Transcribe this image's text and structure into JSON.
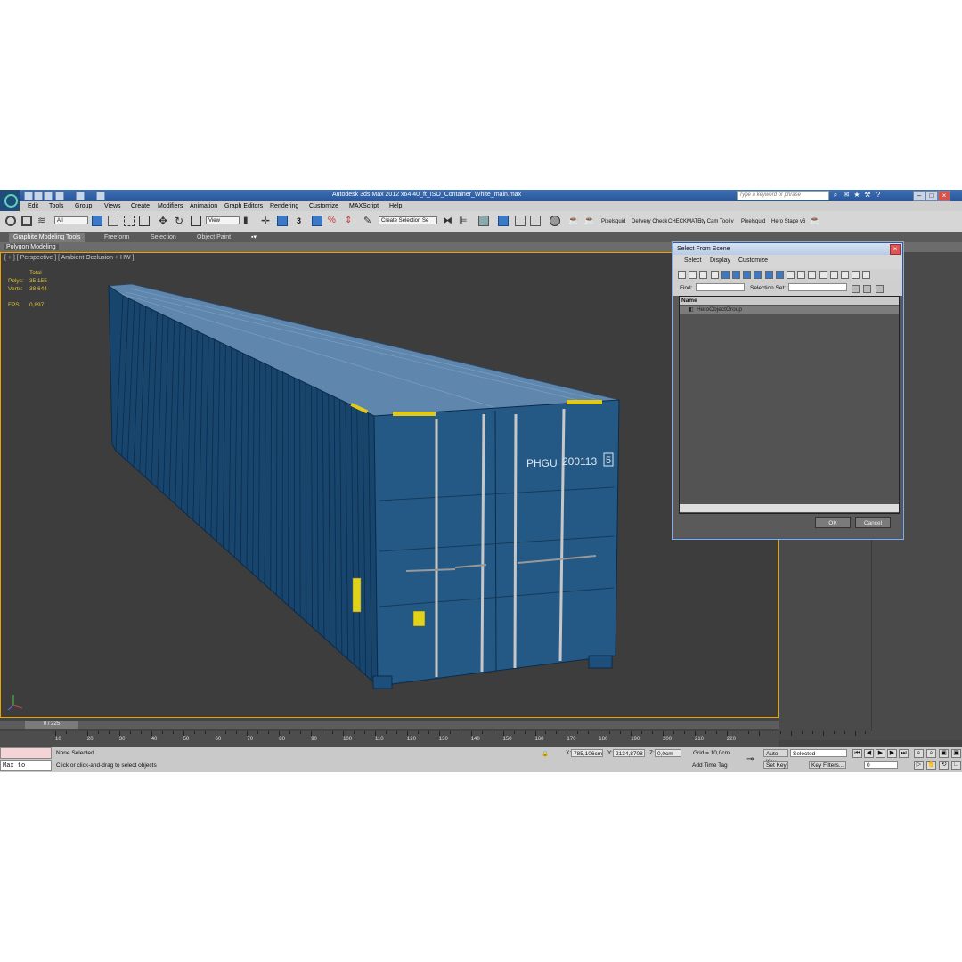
{
  "window": {
    "title": "Autodesk 3ds Max  2012 x64     40_ft_ISO_Container_White_main.max",
    "search_placeholder": "Type a keyword or phrase"
  },
  "menu": [
    "Edit",
    "Tools",
    "Group",
    "Views",
    "Create",
    "Modifiers",
    "Animation",
    "Graph Editors",
    "Rendering",
    "Customize",
    "MAXScript",
    "Help"
  ],
  "toolbar": {
    "selection_filter": "All",
    "reference_coord": "View",
    "named_selection": "Create Selection Se",
    "snap_value": "3",
    "plugins": [
      "Pixelsquid",
      "Delivery Check",
      "CHECKMATE",
      "ity Cam Tool v",
      "Pixelsquid",
      "Hero Stage v6"
    ]
  },
  "ribbon": {
    "tabs": [
      "Graphite Modeling Tools",
      "Freeform",
      "Selection",
      "Object Paint"
    ],
    "panel": "Polygon Modeling"
  },
  "viewport": {
    "label": "[ + ] [ Perspective ] [ Ambient Occlusion + HW ]",
    "stats": {
      "total_label": "Total",
      "polys_label": "Polys:",
      "polys": "35 155",
      "verts_label": "Verts:",
      "verts": "38 644",
      "fps_label": "FPS:",
      "fps": "0,897"
    },
    "container_code": "PHGU",
    "container_number": "200113",
    "container_check": "5"
  },
  "timeline": {
    "frame": "0 / 225",
    "ticks": [
      "10",
      "20",
      "30",
      "40",
      "50",
      "60",
      "70",
      "80",
      "90",
      "100",
      "110",
      "120",
      "130",
      "140",
      "150",
      "160",
      "170",
      "180",
      "190",
      "200",
      "210",
      "220"
    ]
  },
  "status": {
    "maxscript_text": "Max to Physcr",
    "selection_status": "None Selected",
    "prompt": "Click or click-and-drag to select objects",
    "x_label": "X:",
    "x": "785,106cm",
    "y_label": "Y:",
    "y": "2134,8708",
    "z_label": "Z:",
    "z": "0,0cm",
    "grid": "Grid = 10,0cm",
    "add_time_tag": "Add Time Tag",
    "auto_key": "Auto Key",
    "set_key": "Set Key",
    "key_mode": "Selected",
    "key_filters": "Key Filters...",
    "frame_field": "0"
  },
  "dialog": {
    "title": "Select From Scene",
    "menu": [
      "Select",
      "Display",
      "Customize"
    ],
    "find_label": "Find:",
    "selection_set_label": "Selection Set:",
    "column_name": "Name",
    "rows": [
      "HeroObjectGroup"
    ],
    "ok": "OK",
    "cancel": "Cancel"
  },
  "colors": {
    "container": "#1f4f7a",
    "viewport_bg": "#3d3d3d",
    "stats_text": "#e0c23a",
    "active_border": "#eaa300"
  }
}
